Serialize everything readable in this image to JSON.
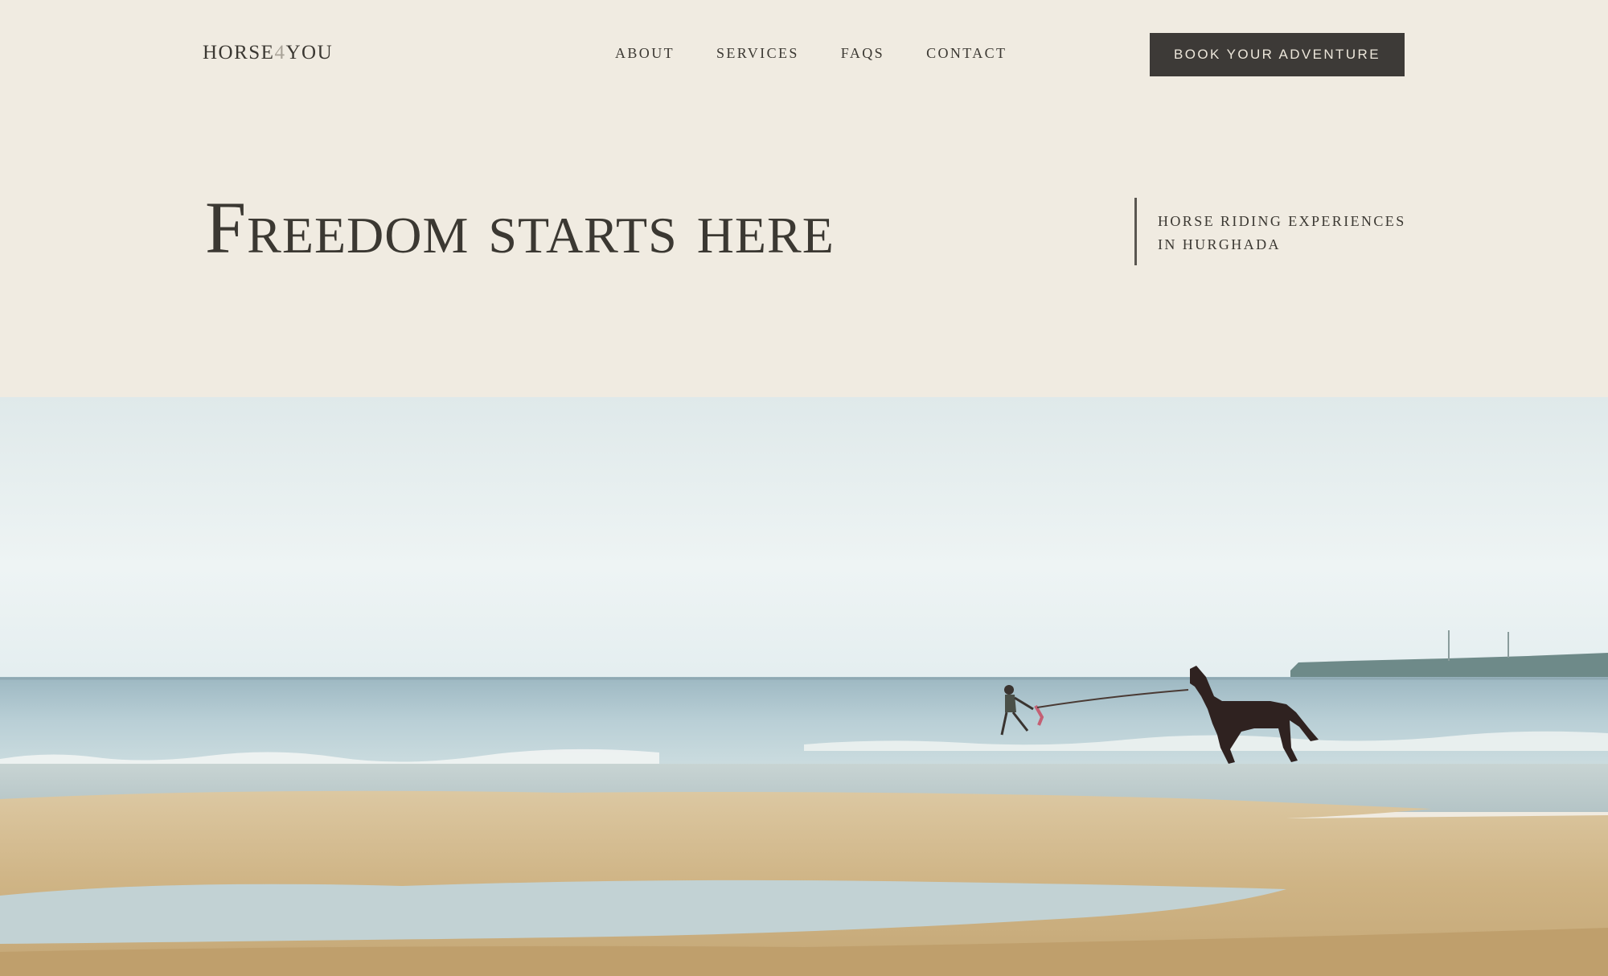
{
  "brand": {
    "logo_prefix": "HORSE",
    "logo_number": "4",
    "logo_suffix": "YOU"
  },
  "nav": {
    "items": [
      {
        "label": "ABOUT"
      },
      {
        "label": "SERVICES"
      },
      {
        "label": "FAQS"
      },
      {
        "label": "CONTACT"
      }
    ]
  },
  "cta": {
    "label": "BOOK YOUR ADVENTURE"
  },
  "hero": {
    "title": "Freedom starts here",
    "tagline_line1": "HORSE RIDING EXPERIENCES",
    "tagline_line2": "IN HURGHADA"
  },
  "colors": {
    "background": "#f0ebe1",
    "text": "#3b3832",
    "button_bg": "#3d3a37",
    "button_text": "#ece6da"
  }
}
